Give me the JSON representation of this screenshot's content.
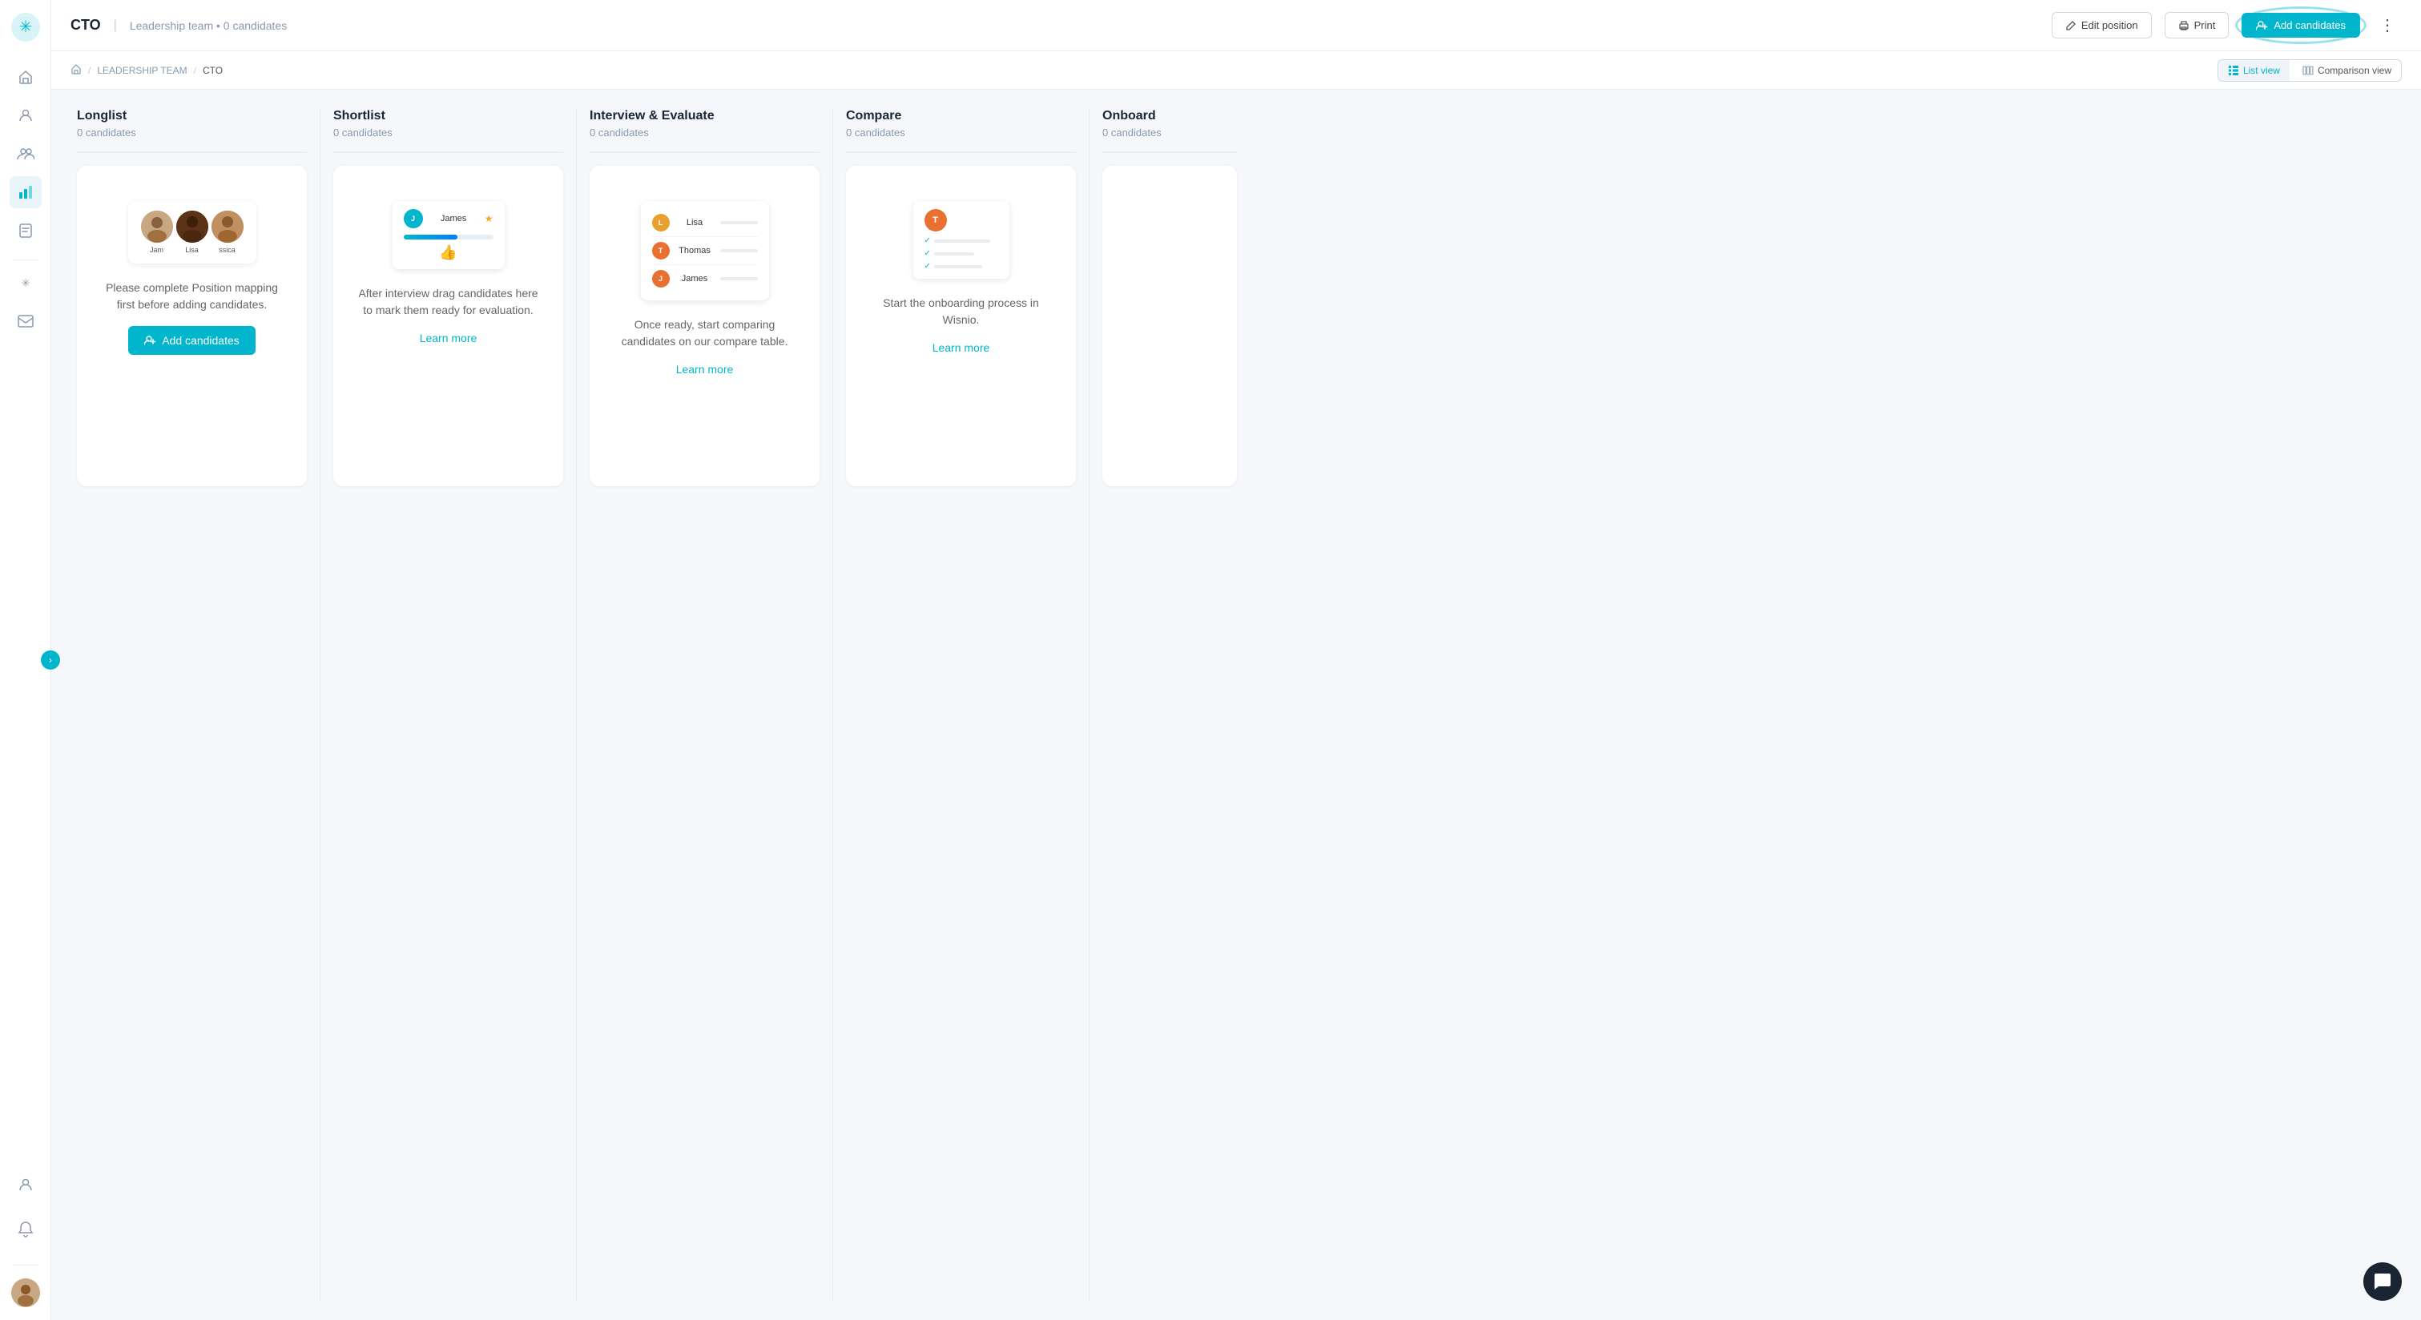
{
  "app": {
    "logo_symbol": "✳",
    "title": "CTO",
    "separator": "|",
    "subtitle": "Leadership team • 0 candidates"
  },
  "header": {
    "edit_position_label": "Edit position",
    "print_label": "Print",
    "add_candidates_label": "Add candidates",
    "more_icon": "⋮"
  },
  "breadcrumb": {
    "home_icon": "⌂",
    "items": [
      "LEADERSHIP TEAM",
      "CTO"
    ],
    "separators": [
      "/",
      "/"
    ]
  },
  "view_toggle": {
    "list_view_label": "List view",
    "comparison_view_label": "Comparison view",
    "list_icon": "▦",
    "comparison_icon": "≡"
  },
  "columns": [
    {
      "id": "longlist",
      "title": "Longlist",
      "count": "0 candidates",
      "card": {
        "type": "longlist",
        "text": "Please complete Position mapping first before adding candidates.",
        "action_label": "Add candidates",
        "people": [
          {
            "name": "Jam",
            "color": "#c8a882"
          },
          {
            "name": "Lisa",
            "color": "#8b4513"
          },
          {
            "name": "ssica",
            "color": "#a0522d"
          }
        ]
      }
    },
    {
      "id": "shortlist",
      "title": "Shortlist",
      "count": "0 candidates",
      "card": {
        "type": "shortlist",
        "candidate_name": "James",
        "text": "After interview drag candidates here to mark them ready for evaluation.",
        "learn_more": "Learn more"
      }
    },
    {
      "id": "interview",
      "title": "Interview & Evaluate",
      "count": "0 candidates",
      "card": {
        "type": "interview",
        "candidates": [
          "Lisa",
          "Thomas",
          "James"
        ],
        "text": "Once ready, start comparing candidates on our compare table.",
        "learn_more": "Learn more"
      }
    },
    {
      "id": "compare",
      "title": "Compare",
      "count": "0 candidates",
      "card": {
        "type": "compare",
        "text": "Start the onboarding process in Wisnio.",
        "learn_more": "Learn more"
      }
    },
    {
      "id": "onboard",
      "title": "Onboard",
      "count": "0 candidates",
      "card": {
        "type": "onboard",
        "text": ""
      }
    }
  ],
  "sidebar": {
    "icons": [
      {
        "name": "home-icon",
        "symbol": "⌂",
        "active": false
      },
      {
        "name": "people-icon",
        "symbol": "👤",
        "active": false
      },
      {
        "name": "team-icon",
        "symbol": "👥",
        "active": false
      },
      {
        "name": "chart-icon",
        "symbol": "▦",
        "active": true
      },
      {
        "name": "notes-icon",
        "symbol": "📋",
        "active": false
      },
      {
        "name": "ai-icon",
        "symbol": "✳",
        "active": false
      }
    ],
    "bottom_icons": [
      {
        "name": "user-icon",
        "symbol": "👤"
      },
      {
        "name": "bell-icon",
        "symbol": "🔔"
      }
    ]
  },
  "chat": {
    "icon": "💬"
  }
}
